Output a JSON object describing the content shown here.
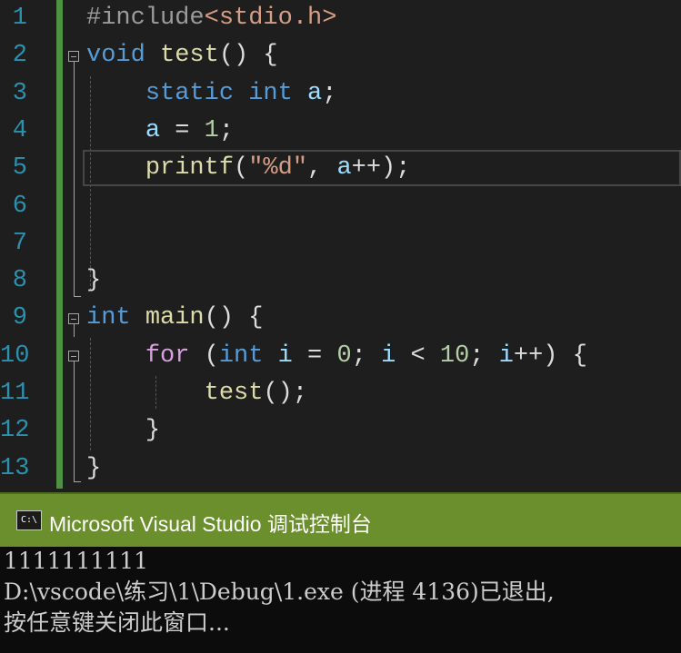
{
  "editor": {
    "line_numbers": [
      "1",
      "2",
      "3",
      "4",
      "5",
      "6",
      "7",
      "8",
      "9",
      "10",
      "11",
      "12",
      "13"
    ],
    "lines": {
      "l1": {
        "hash": "#include",
        "header": "<stdio.h>"
      },
      "l2": {
        "void": "void",
        "sp1": " ",
        "name": "test",
        "rest": "() {"
      },
      "l3": {
        "indent": "    ",
        "static": "static",
        "sp1": " ",
        "int": "int",
        "sp2": " ",
        "var": "a",
        "semi": ";"
      },
      "l4": {
        "indent": "    ",
        "var": "a",
        "eq": " = ",
        "num": "1",
        "semi": ";"
      },
      "l5": {
        "indent": "    ",
        "fn": "printf",
        "open": "(",
        "str": "\"%d\"",
        "comma": ", ",
        "var": "a",
        "rest": "++);"
      },
      "l8": {
        "brace": "}"
      },
      "l9": {
        "int": "int",
        "sp1": " ",
        "name": "main",
        "rest": "() {"
      },
      "l10": {
        "indent": "    ",
        "for": "for",
        "sp1": " (",
        "int": "int",
        "sp2": " ",
        "i1": "i",
        "eq": " = ",
        "zero": "0",
        "semi1": "; ",
        "i2": "i",
        "lt": " < ",
        "ten": "10",
        "semi2": "; ",
        "i3": "i",
        "rest": "++) {"
      },
      "l11": {
        "indent": "        ",
        "fn": "test",
        "rest": "();"
      },
      "l12": {
        "indent": "    ",
        "brace": "}"
      },
      "l13": {
        "brace": "}"
      }
    }
  },
  "console": {
    "title": "Microsoft Visual Studio 调试控制台",
    "icon": "console-window-icon",
    "icon_text": "C:\\",
    "output_lines": [
      "1111111111",
      "D:\\vscode\\练习\\1\\Debug\\1.exe (进程 4136)已退出,",
      "按任意键关闭此窗口..."
    ]
  },
  "colors": {
    "editor_bg": "#1e1e1e",
    "line_number": "#2b91af",
    "keyword": "#569cd6",
    "function": "#dcdcaa",
    "variable": "#9cdcfe",
    "string": "#d69d85",
    "number": "#b5cea8",
    "control": "#d8a0df",
    "console_title_bg": "#6a8f2c",
    "console_bg": "#0c0c0c"
  }
}
